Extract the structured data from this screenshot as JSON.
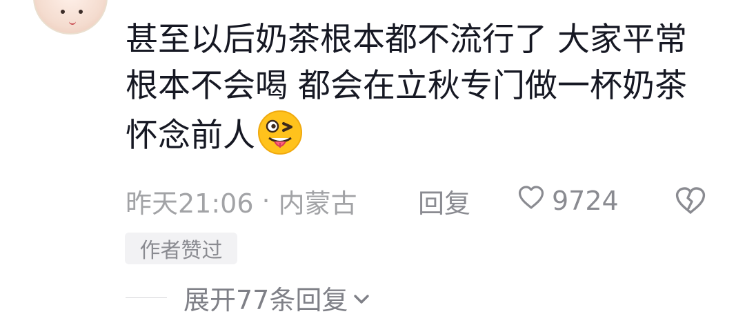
{
  "avatar": {
    "icon": "child-avatar"
  },
  "comment": {
    "text": "甚至以后奶茶根本都不流行了 大家平常根本不会喝 都会在立秋专门做一杯奶茶怀念前人",
    "emoji": "tongue-wink-emoji"
  },
  "meta": {
    "time": "昨天21:06",
    "dot": "·",
    "location": "内蒙古"
  },
  "actions": {
    "reply_label": "回复",
    "like_count": "9724",
    "like_icon": "heart-outline-icon",
    "dislike_icon": "broken-heart-icon"
  },
  "badge": {
    "author_liked": "作者赞过"
  },
  "expand": {
    "label": "展开77条回复",
    "icon": "chevron-down-icon"
  },
  "colors": {
    "text": "#161823",
    "meta": "#a2a3a6",
    "secondary": "#8a8b91",
    "badge_bg": "#f2f2f4"
  }
}
